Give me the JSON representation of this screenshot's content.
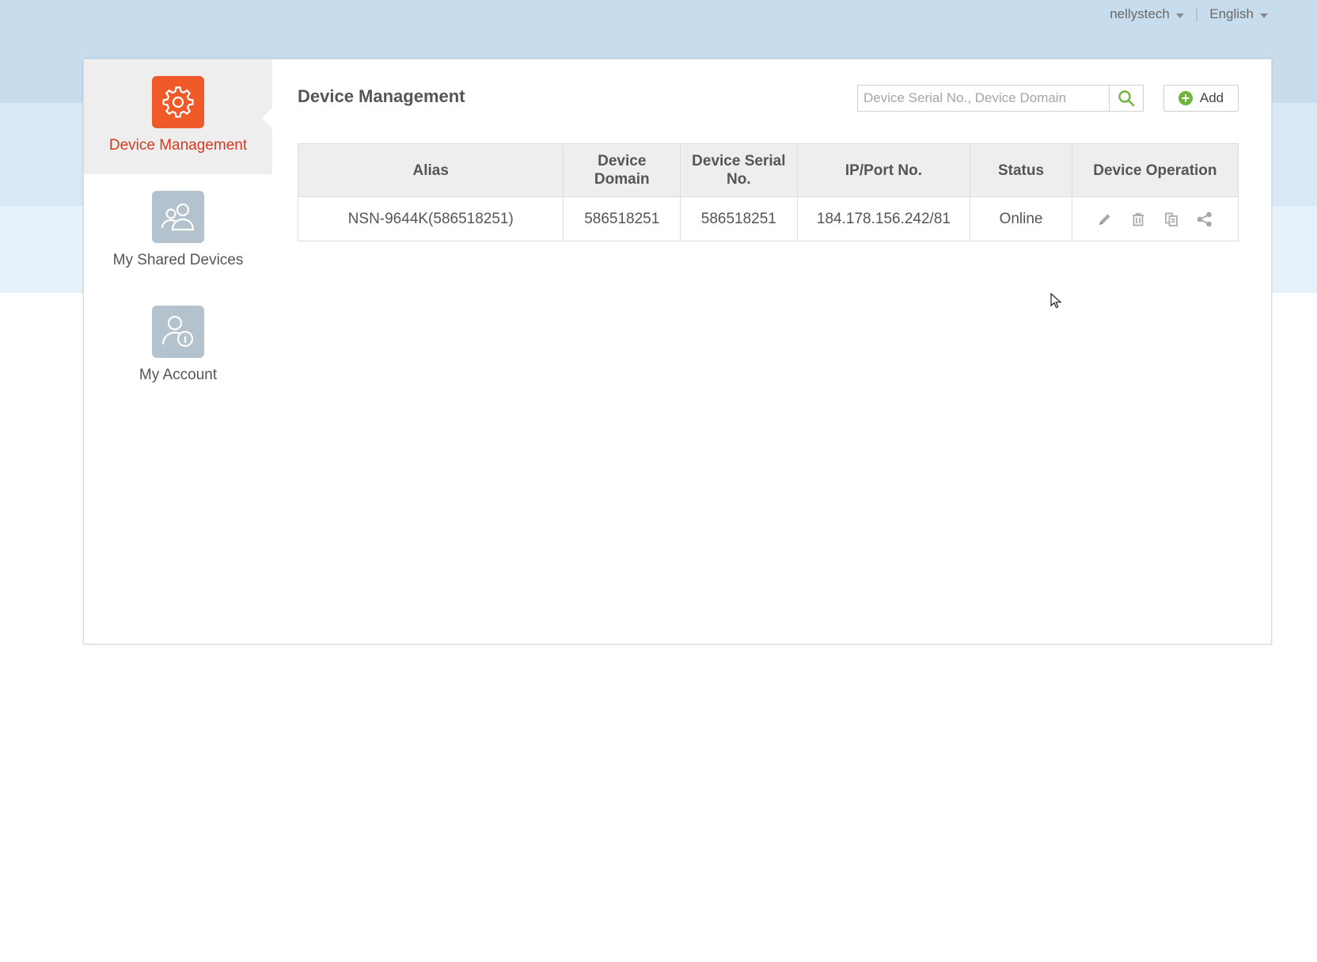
{
  "header": {
    "username": "nellystech",
    "language": "English"
  },
  "sidebar": {
    "items": [
      {
        "label": "Device Management",
        "icon": "gear-icon",
        "active": true
      },
      {
        "label": "My Shared Devices",
        "icon": "users-icon",
        "active": false
      },
      {
        "label": "My Account",
        "icon": "account-info-icon",
        "active": false
      }
    ]
  },
  "main": {
    "title": "Device Management",
    "search": {
      "placeholder": "Device Serial No., Device Domain",
      "value": ""
    },
    "add_label": "Add",
    "table": {
      "columns": [
        "Alias",
        "Device Domain",
        "Device Serial No.",
        "IP/Port No.",
        "Status",
        "Device Operation"
      ],
      "rows": [
        {
          "alias": "NSN-9644K(586518251)",
          "domain": "586518251",
          "serial": "586518251",
          "ip_port": "184.178.156.242/81",
          "status": "Online",
          "operations": [
            "edit-icon",
            "delete-icon",
            "copy-icon",
            "share-icon"
          ]
        }
      ]
    }
  },
  "colors": {
    "accent": "#f05a28",
    "active_text": "#d53a1e",
    "link": "#1a7cc8",
    "online": "#58a829",
    "background_top": "#c7dcec"
  }
}
